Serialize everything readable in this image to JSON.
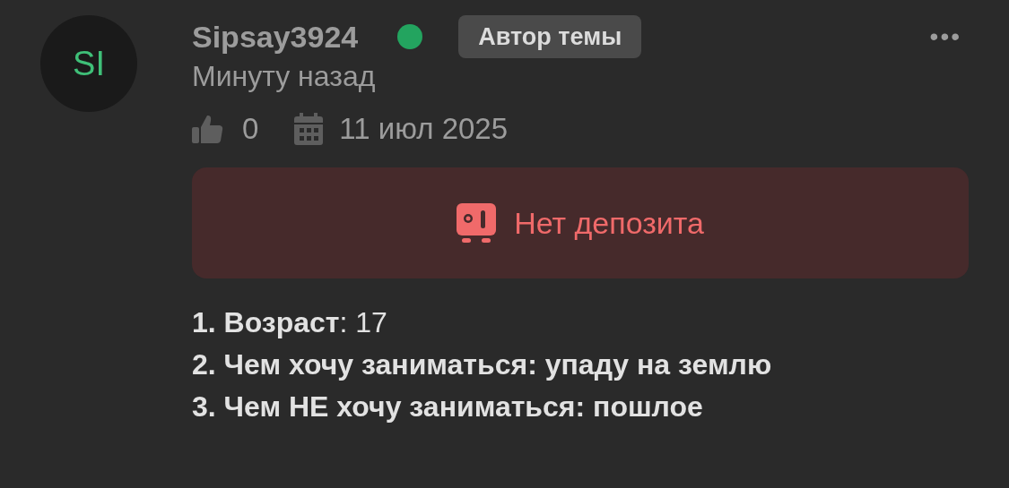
{
  "post": {
    "avatar": {
      "initials": "SI"
    },
    "author": {
      "name": "Sipsay3924",
      "online": true,
      "badge": "Автор темы"
    },
    "menu": "•••",
    "time": "Минуту назад",
    "likes": "0",
    "date": "11 июл 2025",
    "deposit_banner": {
      "text": "Нет депозита"
    },
    "body": [
      "**1. Возраст**: 17",
      "**2. Чем хочу заниматься: упаду на землю**",
      "**3. Чем НЕ хочу заниматься: пошлое**"
    ]
  }
}
